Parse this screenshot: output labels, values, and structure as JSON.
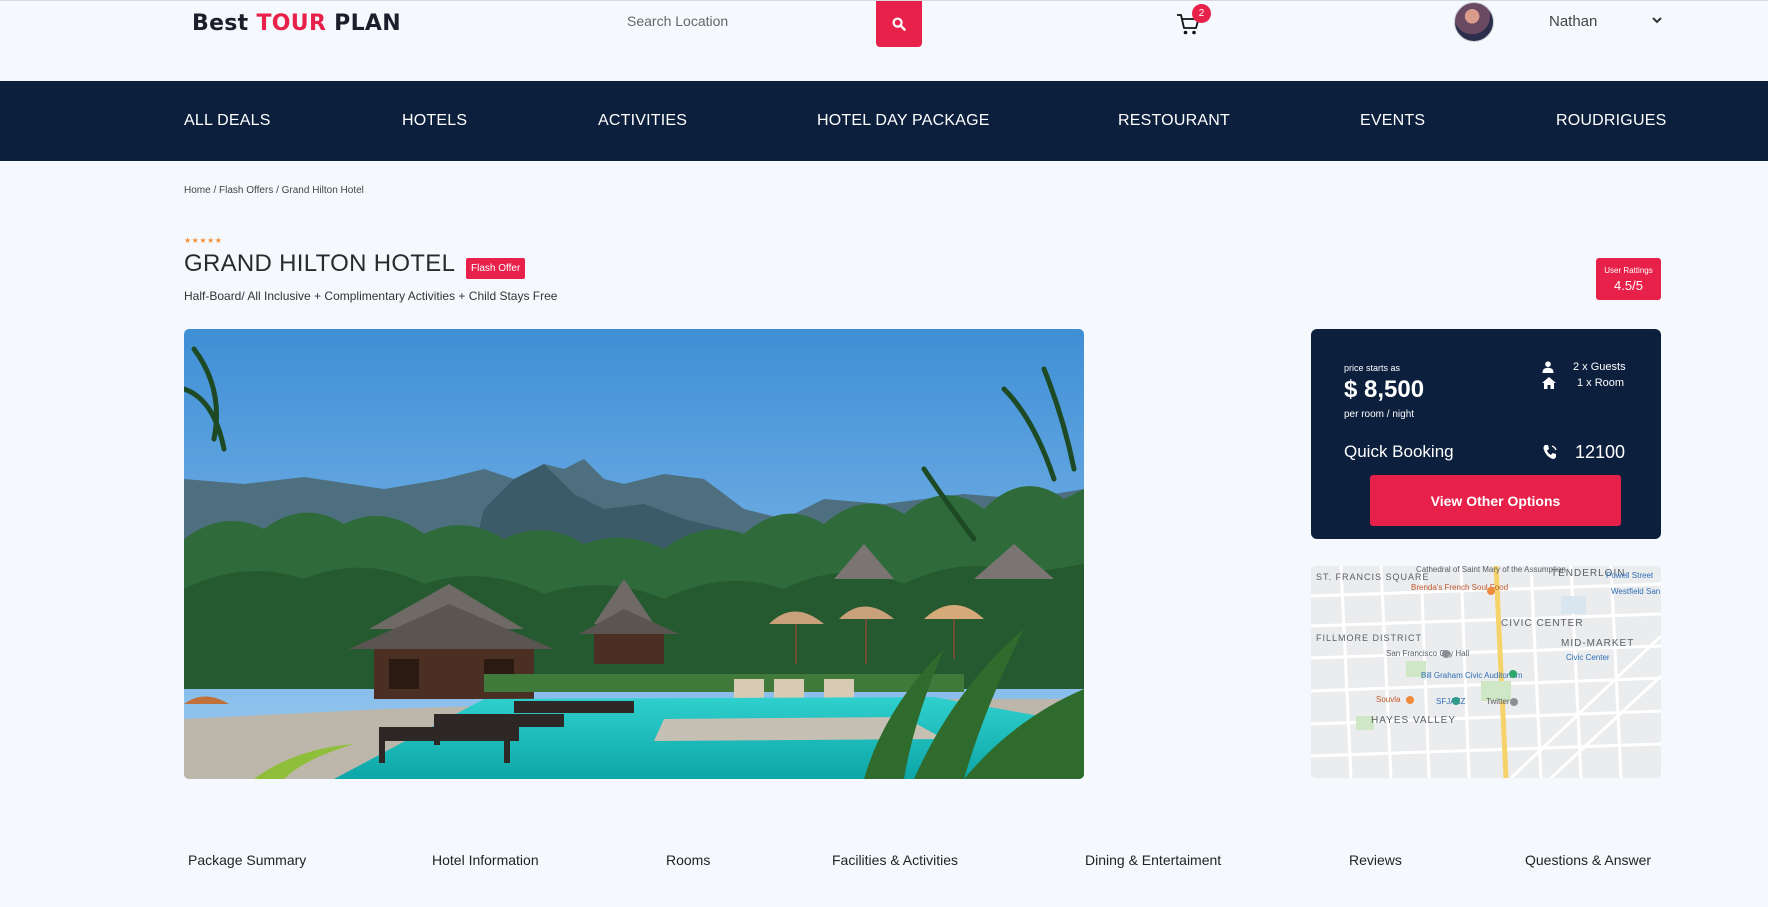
{
  "header": {
    "logo": {
      "part1": "Best ",
      "part2": "TOUR",
      "part3": " PLAN"
    },
    "search": {
      "placeholder": "Search Location"
    },
    "cart": {
      "count": "2"
    },
    "user": {
      "name": "Nathan"
    }
  },
  "nav": {
    "items": [
      "ALL DEALS",
      "HOTELS",
      "ACTIVITIES",
      "HOTEL DAY PACKAGE",
      "RESTOURANT",
      "EVENTS",
      "ROUDRIGUES"
    ]
  },
  "breadcrumb": "Home / Flash Offers / Grand Hilton Hotel",
  "hotel": {
    "stars": "★★★★★",
    "title": "GRAND HILTON HOTEL",
    "badge": "Flash Offer",
    "subtitle": "Half-Board/ All Inclusive + Complimentary Activities + Child Stays Free",
    "rating_label": "User Rattings",
    "rating_value": "4.5/5"
  },
  "booking": {
    "starts_label": "price starts as",
    "price": "$ 8,500",
    "unit": "per room / night",
    "guests": "2 x Guests",
    "rooms": "1 x Room",
    "quick_label": "Quick Booking",
    "phone": "12100",
    "button": "View Other Options"
  },
  "map": {
    "labels": [
      "Cathedral of Saint Mary of the Assumption",
      "ST. FRANCIS SQUARE",
      "TENDERLOIN",
      "Powell Street",
      "Westfield San Francisco Centre",
      "Brenda's French Soul Food",
      "CIVIC CENTER",
      "FILLMORE DISTRICT",
      "MID-MARKET",
      "San Francisco City Hall",
      "Civic Center",
      "Bill Graham Civic Auditorium",
      "Souvla",
      "SFJAZZ",
      "Twitter",
      "HAYES VALLEY"
    ]
  },
  "tabs": [
    "Package Summary",
    "Hotel Information",
    "Rooms",
    "Facilities & Activities",
    "Dining & Entertaiment",
    "Reviews",
    "Questions & Answer"
  ],
  "colors": {
    "accent": "#e8214a",
    "navy": "#0c1f3d",
    "background": "#f5f9fd",
    "stars": "#f4913a"
  }
}
